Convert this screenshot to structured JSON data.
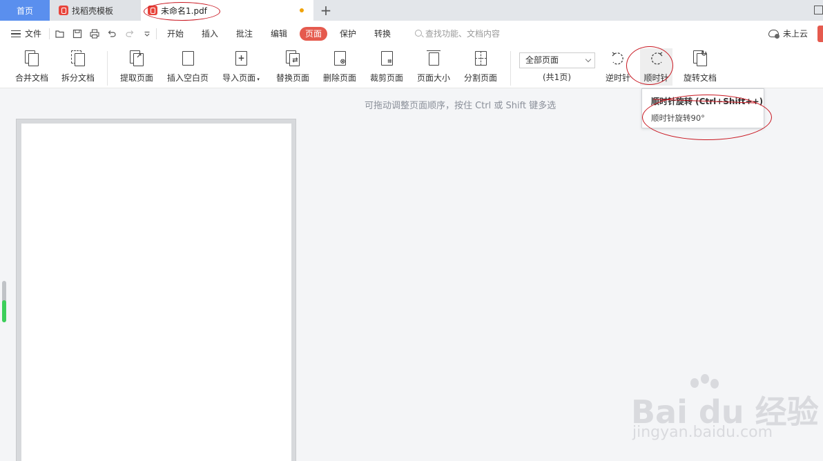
{
  "tabs": {
    "home": "首页",
    "template": "找稻壳模板",
    "document": "未命名1.pdf",
    "new_tab": "+"
  },
  "menu": {
    "file": "文件",
    "items": [
      "开始",
      "插入",
      "批注",
      "编辑",
      "页面",
      "保护",
      "转换"
    ],
    "active": "页面",
    "search_placeholder": "查找功能、文档内容",
    "cloud_status": "未上云"
  },
  "ribbon": {
    "buttons": [
      {
        "label": "合并文档",
        "icon": "merge-doc-icon"
      },
      {
        "label": "拆分文档",
        "icon": "split-doc-icon"
      },
      {
        "label": "提取页面",
        "icon": "extract-page-icon"
      },
      {
        "label": "插入空白页",
        "icon": "insert-blank-page-icon"
      },
      {
        "label": "导入页面",
        "icon": "import-page-icon"
      },
      {
        "label": "替换页面",
        "icon": "replace-page-icon"
      },
      {
        "label": "删除页面",
        "icon": "delete-page-icon"
      },
      {
        "label": "裁剪页面",
        "icon": "crop-page-icon"
      },
      {
        "label": "页面大小",
        "icon": "page-size-icon"
      },
      {
        "label": "分割页面",
        "icon": "split-page-icon"
      }
    ],
    "page_range": "全部页面",
    "page_count": "(共1页)",
    "rotate_ccw": "逆时针",
    "rotate_cw": "顺时针",
    "rotate_doc": "旋转文档"
  },
  "content": {
    "hint": "可拖动调整页面顺序，按住 Ctrl 或 Shift 键多选"
  },
  "tooltip": {
    "title": "顺时针旋转 (Ctrl+Shift++)",
    "description": "顺时针旋转90°"
  },
  "watermark": {
    "logo": "Bai du 经验",
    "url": "jingyan.baidu.com"
  },
  "colors": {
    "home_tab": "#5a8fee",
    "active_menu": "#e55a4e",
    "annotation": "#c8141e",
    "scroll_accent": "#3ccf5a"
  }
}
